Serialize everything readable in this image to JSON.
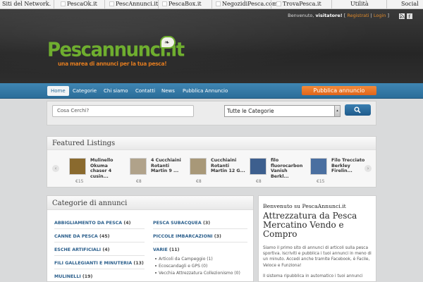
{
  "network_bar": {
    "label": "Siti del Network.",
    "sites": [
      "PescaOk.it",
      "PescAnnunci.it",
      "PescaBox.it",
      "NegozidiPesca.com",
      "TrovaPesca.it"
    ],
    "utility": "Utilità",
    "social": "Social"
  },
  "header": {
    "welcome_prefix": "Benvenuto,",
    "welcome_user": "visitatore!",
    "register": "Registrati",
    "login": "Login",
    "logo_text": "Pescannunci.it",
    "tagline": "una marea di annunci per la tua pesca!"
  },
  "nav": {
    "items": [
      "Home",
      "Categorie",
      "Chi siamo",
      "Contatti",
      "News",
      "Pubblica Annuncio"
    ],
    "active": "Home",
    "cta": "Pubblica annuncio"
  },
  "search": {
    "placeholder": "Cosa Cerchi?",
    "category_selected": "Tutte le Categorie",
    "button_icon": "search-icon"
  },
  "featured": {
    "title": "Featured Listings",
    "listings": [
      {
        "title": "Mulinello Okuma chaser 4 cusin...",
        "price": "€15",
        "thumb_color": "#8a6a2e"
      },
      {
        "title": "4 Cucchiaini Rotanti Martin 9 ...",
        "price": "€8",
        "thumb_color": "#b0a28a"
      },
      {
        "title": "Cucchiaini Rotanti Martin 12 G...",
        "price": "€8",
        "thumb_color": "#a89878"
      },
      {
        "title": "filo fluorocarbon Vanish Berkl...",
        "price": "€8",
        "thumb_color": "#3d5f8e"
      },
      {
        "title": "Filo Trecciato Berkley Firelin...",
        "price": "€15",
        "thumb_color": "#4a6fa0"
      }
    ]
  },
  "categories": {
    "title": "Categorie di annunci",
    "left": [
      {
        "name": "ABBIGLIAMENTO DA PESCA",
        "count": "(4)"
      },
      {
        "name": "CANNE DA PESCA",
        "count": "(45)"
      },
      {
        "name": "ESCHE ARTIFICIALI",
        "count": "(4)"
      },
      {
        "name": "FILI GALLEGIANTI E MINUTERIA",
        "count": "(13)"
      },
      {
        "name": "MULINELLI",
        "count": "(19)"
      }
    ],
    "right": [
      {
        "name": "PESCA SUBACQUEA",
        "count": "(3)"
      },
      {
        "name": "PICCOLE IMBARCAZIONI",
        "count": "(3)"
      },
      {
        "name": "VARIE",
        "count": "(11)"
      }
    ],
    "varie_sub": [
      "Articoli da Campeggio (1)",
      "Ecoscandagli e GPS (0)",
      "Vecchia Attrezzatura Collezionismo (0)"
    ]
  },
  "welcome_panel": {
    "subtitle": "Benvenuto su PescaAnnunci.it",
    "title": "Attrezzatura da Pesca Mercatino Vendo e Compro",
    "paragraph1": "Siamo il primo sito di annunci di articoli sulla pesca sportiva. Iscriviti e pubblica i tuoi annunci in meno di un minuto. Accedi anche tramite Facebook, è Facile, Veloce e Funziona!",
    "paragraph2": "Il sistema ripubblica in automatico i tuoi annunci"
  },
  "colors": {
    "brand_green": "#6fae2f",
    "brand_orange": "#e07b20",
    "nav_blue": "#2b6d99",
    "link_blue": "#2b5f8c"
  }
}
